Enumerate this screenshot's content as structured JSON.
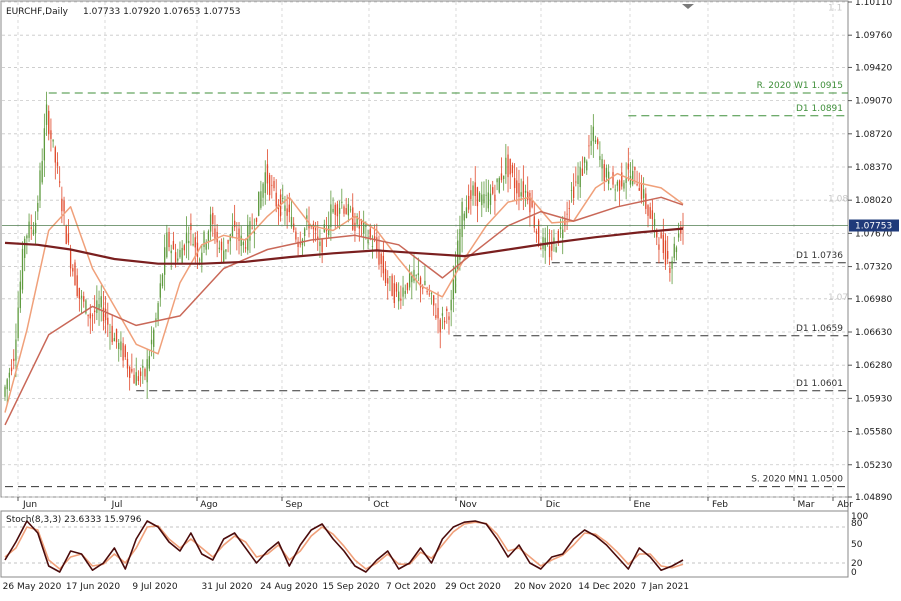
{
  "header": {
    "symbol": "EURCHF,Daily",
    "ohlc": "1.07733 1.07920 1.07653 1.07753"
  },
  "colors": {
    "bull": "#5e9a3e",
    "bear": "#e0492b",
    "ma_fast": "#f0a07a",
    "ma_mid": "#c96858",
    "ma_slow": "#7a1f1f",
    "level_green": "#3f8f3a",
    "level_dark": "#333333",
    "price_box": "#1f3a7a",
    "stoch_main": "#4a0b0b",
    "stoch_signal": "#f0a07a"
  },
  "chart_data": [
    {
      "type": "candlestick",
      "symbol": "EURCHF",
      "timeframe": "Daily",
      "ylim": [
        1.0489,
        1.1011
      ],
      "y_ticks": [
        "1.10110",
        "1.09760",
        "1.09420",
        "1.09070",
        "1.08720",
        "1.08370",
        "1.08020",
        "1.07670",
        "1.07320",
        "1.06980",
        "1.06630",
        "1.06280",
        "1.05930",
        "1.05580",
        "1.05230",
        "1.04890"
      ],
      "x_month_labels": [
        "Jun",
        "Jul",
        "Ago",
        "Sep",
        "Oct",
        "Nov",
        "Dic",
        "Ene",
        "Feb",
        "Mar",
        "Abr"
      ],
      "x_date_labels": [
        "26 May 2020",
        "17 Jun 2020",
        "9 Jul 2020",
        "31 Jul 2020",
        "24 Aug 2020",
        "15 Sep 2020",
        "7 Oct 2020",
        "29 Oct 2020",
        "20 Nov 2020",
        "14 Dec 2020",
        "7 Jan 2021"
      ],
      "current_price": "1.07753",
      "trend_points": [
        [
          0,
          1.0595
        ],
        [
          5,
          1.064
        ],
        [
          10,
          1.0765
        ],
        [
          15,
          1.078
        ],
        [
          20,
          1.0895
        ],
        [
          25,
          1.083
        ],
        [
          30,
          1.075
        ],
        [
          35,
          1.07
        ],
        [
          40,
          1.068
        ],
        [
          45,
          1.069
        ],
        [
          50,
          1.066
        ],
        [
          55,
          1.064
        ],
        [
          60,
          1.0615
        ],
        [
          65,
          1.0618
        ],
        [
          70,
          1.0675
        ],
        [
          75,
          1.076
        ],
        [
          80,
          1.074
        ],
        [
          85,
          1.077
        ],
        [
          90,
          1.0745
        ],
        [
          95,
          1.078
        ],
        [
          100,
          1.0745
        ],
        [
          105,
          1.077
        ],
        [
          110,
          1.0755
        ],
        [
          115,
          1.078
        ],
        [
          120,
          1.083
        ],
        [
          125,
          1.08
        ],
        [
          130,
          1.079
        ],
        [
          135,
          1.076
        ],
        [
          140,
          1.078
        ],
        [
          145,
          1.075
        ],
        [
          150,
          1.079
        ],
        [
          155,
          1.08
        ],
        [
          160,
          1.078
        ],
        [
          165,
          1.077
        ],
        [
          170,
          1.0755
        ],
        [
          175,
          1.072
        ],
        [
          180,
          1.07
        ],
        [
          185,
          1.0715
        ],
        [
          190,
          1.072
        ],
        [
          195,
          1.07
        ],
        [
          200,
          1.0672
        ],
        [
          205,
          1.069
        ],
        [
          210,
          1.079
        ],
        [
          215,
          1.081
        ],
        [
          220,
          1.08
        ],
        [
          225,
          1.0812
        ],
        [
          230,
          1.084
        ],
        [
          235,
          1.0815
        ],
        [
          240,
          1.081
        ],
        [
          245,
          1.076
        ],
        [
          250,
          1.0748
        ],
        [
          255,
          1.077
        ],
        [
          260,
          1.081
        ],
        [
          265,
          1.0835
        ],
        [
          270,
          1.087
        ],
        [
          275,
          1.083
        ],
        [
          280,
          1.0815
        ],
        [
          285,
          1.083
        ],
        [
          290,
          1.0825
        ],
        [
          295,
          1.079
        ],
        [
          300,
          1.076
        ],
        [
          305,
          1.0735
        ],
        [
          310,
          1.0775
        ]
      ],
      "ma_fast": [
        [
          0,
          1.0578
        ],
        [
          10,
          1.0665
        ],
        [
          20,
          1.077
        ],
        [
          30,
          1.0795
        ],
        [
          40,
          1.073
        ],
        [
          50,
          1.069
        ],
        [
          60,
          1.065
        ],
        [
          70,
          1.064
        ],
        [
          80,
          1.0715
        ],
        [
          90,
          1.0755
        ],
        [
          100,
          1.0765
        ],
        [
          110,
          1.076
        ],
        [
          120,
          1.0785
        ],
        [
          130,
          1.0805
        ],
        [
          140,
          1.0775
        ],
        [
          150,
          1.077
        ],
        [
          160,
          1.0785
        ],
        [
          170,
          1.077
        ],
        [
          180,
          1.074
        ],
        [
          190,
          1.0712
        ],
        [
          200,
          1.07
        ],
        [
          210,
          1.074
        ],
        [
          220,
          1.0775
        ],
        [
          230,
          1.08
        ],
        [
          240,
          1.0805
        ],
        [
          250,
          1.0778
        ],
        [
          260,
          1.078
        ],
        [
          270,
          1.0815
        ],
        [
          280,
          1.083
        ],
        [
          290,
          1.082
        ],
        [
          300,
          1.0815
        ],
        [
          310,
          1.0798
        ]
      ],
      "ma_mid": [
        [
          0,
          1.0565
        ],
        [
          20,
          1.066
        ],
        [
          40,
          1.069
        ],
        [
          60,
          1.067
        ],
        [
          80,
          1.068
        ],
        [
          100,
          1.073
        ],
        [
          120,
          1.075
        ],
        [
          140,
          1.076
        ],
        [
          160,
          1.0765
        ],
        [
          180,
          1.0755
        ],
        [
          200,
          1.072
        ],
        [
          215,
          1.0748
        ],
        [
          230,
          1.0775
        ],
        [
          245,
          1.079
        ],
        [
          260,
          1.078
        ],
        [
          280,
          1.0795
        ],
        [
          300,
          1.0805
        ],
        [
          310,
          1.0797
        ]
      ],
      "ma_slow": [
        [
          0,
          1.0757
        ],
        [
          15,
          1.0755
        ],
        [
          30,
          1.075
        ],
        [
          50,
          1.074
        ],
        [
          70,
          1.0735
        ],
        [
          90,
          1.0735
        ],
        [
          110,
          1.0737
        ],
        [
          130,
          1.0742
        ],
        [
          150,
          1.0746
        ],
        [
          170,
          1.0749
        ],
        [
          190,
          1.0746
        ],
        [
          210,
          1.0743
        ],
        [
          230,
          1.075
        ],
        [
          250,
          1.0757
        ],
        [
          270,
          1.0763
        ],
        [
          290,
          1.0768
        ],
        [
          310,
          1.0772
        ]
      ],
      "levels": [
        {
          "label": "R. 2020 W1 1.0915",
          "price": 1.0915,
          "from": 20,
          "style": "green"
        },
        {
          "label": "D1 1.0891",
          "price": 1.0891,
          "from": 285,
          "style": "green"
        },
        {
          "label": "D1 1.0736",
          "price": 1.0736,
          "from": 250,
          "style": "dark"
        },
        {
          "label": "D1 1.0659",
          "price": 1.0659,
          "from": 205,
          "style": "dark"
        },
        {
          "label": "D1 1.0601",
          "price": 1.0601,
          "from": 60,
          "style": "dark"
        },
        {
          "label": "S. 2020 MN1 1.0500",
          "price": 1.05,
          "from": 0,
          "style": "dark"
        }
      ],
      "faint_labels": [
        "1.08",
        "1.07",
        "1.1"
      ]
    },
    {
      "type": "line",
      "title": "Stoch(8,3,3) 23.6333 15.9796",
      "ylim": [
        0,
        100
      ],
      "y_ticks": [
        "100",
        "80",
        "50",
        "20",
        "0"
      ],
      "levels": [
        80,
        20
      ],
      "main": [
        [
          0,
          25
        ],
        [
          5,
          55
        ],
        [
          10,
          90
        ],
        [
          15,
          70
        ],
        [
          20,
          15
        ],
        [
          25,
          5
        ],
        [
          30,
          40
        ],
        [
          35,
          35
        ],
        [
          40,
          8
        ],
        [
          45,
          20
        ],
        [
          50,
          45
        ],
        [
          55,
          10
        ],
        [
          60,
          60
        ],
        [
          65,
          90
        ],
        [
          70,
          80
        ],
        [
          75,
          55
        ],
        [
          80,
          40
        ],
        [
          85,
          70
        ],
        [
          90,
          35
        ],
        [
          95,
          25
        ],
        [
          100,
          60
        ],
        [
          105,
          70
        ],
        [
          110,
          45
        ],
        [
          115,
          20
        ],
        [
          120,
          40
        ],
        [
          125,
          55
        ],
        [
          130,
          15
        ],
        [
          135,
          50
        ],
        [
          140,
          75
        ],
        [
          145,
          85
        ],
        [
          150,
          60
        ],
        [
          155,
          40
        ],
        [
          160,
          15
        ],
        [
          165,
          5
        ],
        [
          170,
          25
        ],
        [
          175,
          40
        ],
        [
          180,
          10
        ],
        [
          185,
          20
        ],
        [
          190,
          45
        ],
        [
          195,
          20
        ],
        [
          200,
          60
        ],
        [
          205,
          80
        ],
        [
          210,
          88
        ],
        [
          215,
          90
        ],
        [
          220,
          85
        ],
        [
          225,
          60
        ],
        [
          230,
          30
        ],
        [
          235,
          50
        ],
        [
          240,
          20
        ],
        [
          245,
          10
        ],
        [
          250,
          30
        ],
        [
          255,
          35
        ],
        [
          260,
          60
        ],
        [
          265,
          75
        ],
        [
          270,
          65
        ],
        [
          275,
          50
        ],
        [
          280,
          30
        ],
        [
          285,
          10
        ],
        [
          290,
          45
        ],
        [
          295,
          30
        ],
        [
          300,
          8
        ],
        [
          305,
          15
        ],
        [
          310,
          25
        ]
      ],
      "signal": [
        [
          0,
          30
        ],
        [
          5,
          45
        ],
        [
          10,
          80
        ],
        [
          15,
          75
        ],
        [
          20,
          25
        ],
        [
          25,
          10
        ],
        [
          30,
          30
        ],
        [
          35,
          35
        ],
        [
          40,
          15
        ],
        [
          45,
          18
        ],
        [
          50,
          35
        ],
        [
          55,
          20
        ],
        [
          60,
          45
        ],
        [
          65,
          80
        ],
        [
          70,
          82
        ],
        [
          75,
          60
        ],
        [
          80,
          45
        ],
        [
          85,
          60
        ],
        [
          90,
          45
        ],
        [
          95,
          30
        ],
        [
          100,
          50
        ],
        [
          105,
          65
        ],
        [
          110,
          55
        ],
        [
          115,
          30
        ],
        [
          120,
          35
        ],
        [
          125,
          50
        ],
        [
          130,
          25
        ],
        [
          135,
          40
        ],
        [
          140,
          65
        ],
        [
          145,
          80
        ],
        [
          150,
          68
        ],
        [
          155,
          48
        ],
        [
          160,
          25
        ],
        [
          165,
          10
        ],
        [
          170,
          20
        ],
        [
          175,
          35
        ],
        [
          180,
          18
        ],
        [
          185,
          18
        ],
        [
          190,
          38
        ],
        [
          195,
          28
        ],
        [
          200,
          50
        ],
        [
          205,
          72
        ],
        [
          210,
          85
        ],
        [
          215,
          88
        ],
        [
          220,
          86
        ],
        [
          225,
          68
        ],
        [
          230,
          40
        ],
        [
          235,
          45
        ],
        [
          240,
          30
        ],
        [
          245,
          15
        ],
        [
          250,
          25
        ],
        [
          255,
          33
        ],
        [
          260,
          50
        ],
        [
          265,
          70
        ],
        [
          270,
          68
        ],
        [
          275,
          55
        ],
        [
          280,
          38
        ],
        [
          285,
          18
        ],
        [
          290,
          35
        ],
        [
          295,
          35
        ],
        [
          300,
          15
        ],
        [
          305,
          12
        ],
        [
          310,
          18
        ]
      ]
    }
  ]
}
